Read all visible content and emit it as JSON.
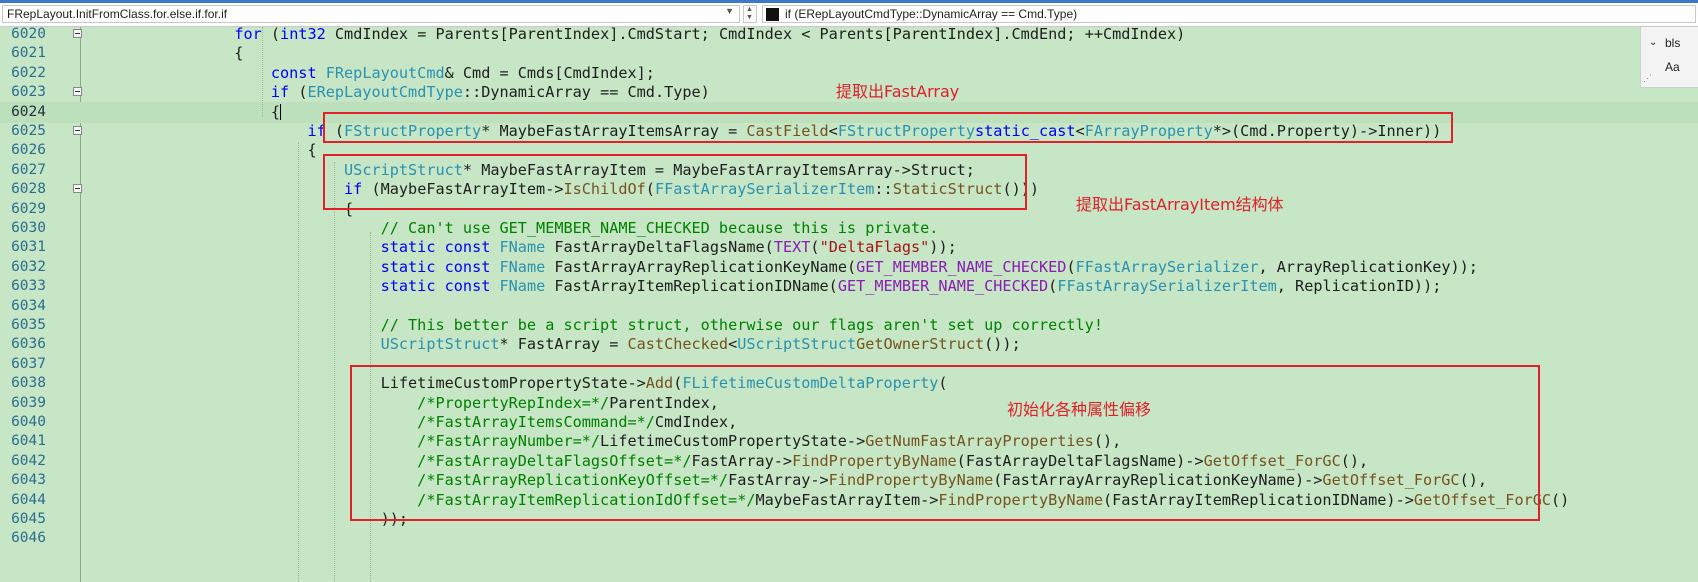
{
  "nav": {
    "scope": "FRepLayout.InitFromClass.for.else.if.for.if",
    "member": "if (ERepLayoutCmdType::DynamicArray == Cmd.Type)"
  },
  "side": {
    "label": "bls",
    "case": "Aa"
  },
  "annotations": {
    "a1": "提取出FastArray",
    "a2": "提取出FastArrayItem结构体",
    "a3": "初始化各种属性偏移"
  },
  "colors": {
    "background": "#c7e6c6",
    "keyword": "#0000ff",
    "type": "#2b91af",
    "function": "#74531f",
    "comment": "#008000",
    "string": "#a31515",
    "annotation": "#e0202a"
  },
  "lines": [
    {
      "n": "6020",
      "fold": true,
      "current": false,
      "tokens": [
        [
          "",
          "                "
        ],
        [
          "kw",
          "for"
        ],
        [
          "",
          " ("
        ],
        [
          "kw",
          "int32"
        ],
        [
          "",
          " CmdIndex = Parents[ParentIndex].CmdStart; CmdIndex < Parents[ParentIndex].CmdEnd; ++CmdIndex)"
        ]
      ]
    },
    {
      "n": "6021",
      "fold": false,
      "current": false,
      "tokens": [
        [
          "",
          "                {"
        ]
      ]
    },
    {
      "n": "6022",
      "fold": false,
      "current": false,
      "tokens": [
        [
          "",
          "                    "
        ],
        [
          "kw",
          "const"
        ],
        [
          "",
          " "
        ],
        [
          "ty",
          "FRepLayoutCmd"
        ],
        [
          "",
          "& Cmd = Cmds[CmdIndex];"
        ]
      ]
    },
    {
      "n": "6023",
      "fold": true,
      "current": false,
      "tokens": [
        [
          "",
          "                    "
        ],
        [
          "kw",
          "if"
        ],
        [
          "",
          " ("
        ],
        [
          "ty",
          "ERepLayoutCmdType"
        ],
        [
          "",
          "::DynamicArray == Cmd.Type)"
        ]
      ]
    },
    {
      "n": "6024",
      "fold": false,
      "current": true,
      "tokens": [
        [
          "",
          "                    {"
        ],
        [
          "caret",
          ""
        ]
      ]
    },
    {
      "n": "6025",
      "fold": true,
      "current": false,
      "tokens": [
        [
          "",
          "                        "
        ],
        [
          "kw",
          "if"
        ],
        [
          "",
          " ("
        ],
        [
          "ty",
          "FStructProperty"
        ],
        [
          "",
          "* MaybeFastArrayItemsArray = "
        ],
        [
          "fn",
          "CastField"
        ],
        [
          "",
          "<"
        ],
        [
          "ty",
          "FStructProperty"
        ],
        [
          ">("
        ],
        [
          "kw",
          "static_cast"
        ],
        [
          "",
          "<"
        ],
        [
          "ty",
          "FArrayProperty"
        ],
        [
          "",
          "*>(Cmd.Property)->Inner))"
        ]
      ]
    },
    {
      "n": "6026",
      "fold": false,
      "current": false,
      "tokens": [
        [
          "",
          "                        {"
        ]
      ]
    },
    {
      "n": "6027",
      "fold": false,
      "current": false,
      "tokens": [
        [
          "",
          "                            "
        ],
        [
          "ty",
          "UScriptStruct"
        ],
        [
          "",
          "* MaybeFastArrayItem = MaybeFastArrayItemsArray->Struct;"
        ]
      ]
    },
    {
      "n": "6028",
      "fold": true,
      "current": false,
      "tokens": [
        [
          "",
          "                            "
        ],
        [
          "kw",
          "if"
        ],
        [
          "",
          " (MaybeFastArrayItem->"
        ],
        [
          "fn",
          "IsChildOf"
        ],
        [
          "",
          "("
        ],
        [
          "ty",
          "FFastArraySerializerItem"
        ],
        [
          "",
          "::"
        ],
        [
          "fn",
          "StaticStruct"
        ],
        [
          "",
          "()))"
        ]
      ]
    },
    {
      "n": "6029",
      "fold": false,
      "current": false,
      "tokens": [
        [
          "",
          "                            {"
        ]
      ]
    },
    {
      "n": "6030",
      "fold": false,
      "current": false,
      "tokens": [
        [
          "",
          "                                "
        ],
        [
          "cm",
          "// Can't use GET_MEMBER_NAME_CHECKED because this is private."
        ]
      ]
    },
    {
      "n": "6031",
      "fold": false,
      "current": false,
      "tokens": [
        [
          "",
          "                                "
        ],
        [
          "kw",
          "static"
        ],
        [
          "",
          " "
        ],
        [
          "kw",
          "const"
        ],
        [
          "",
          " "
        ],
        [
          "ty",
          "FName"
        ],
        [
          "",
          " FastArrayDeltaFlagsName("
        ],
        [
          "mc",
          "TEXT"
        ],
        [
          "",
          "("
        ],
        [
          "st",
          "\"DeltaFlags\""
        ],
        [
          "",
          "));"
        ]
      ]
    },
    {
      "n": "6032",
      "fold": false,
      "current": false,
      "tokens": [
        [
          "",
          "                                "
        ],
        [
          "kw",
          "static"
        ],
        [
          "",
          " "
        ],
        [
          "kw",
          "const"
        ],
        [
          "",
          " "
        ],
        [
          "ty",
          "FName"
        ],
        [
          "",
          " FastArrayArrayReplicationKeyName("
        ],
        [
          "mc",
          "GET_MEMBER_NAME_CHECKED"
        ],
        [
          "",
          "("
        ],
        [
          "ty",
          "FFastArraySerializer"
        ],
        [
          "",
          ", ArrayReplicationKey));"
        ]
      ]
    },
    {
      "n": "6033",
      "fold": false,
      "current": false,
      "tokens": [
        [
          "",
          "                                "
        ],
        [
          "kw",
          "static"
        ],
        [
          "",
          " "
        ],
        [
          "kw",
          "const"
        ],
        [
          "",
          " "
        ],
        [
          "ty",
          "FName"
        ],
        [
          "",
          " FastArrayItemReplicationIDName("
        ],
        [
          "mc",
          "GET_MEMBER_NAME_CHECKED"
        ],
        [
          "",
          "("
        ],
        [
          "ty",
          "FFastArraySerializerItem"
        ],
        [
          "",
          ", ReplicationID));"
        ]
      ]
    },
    {
      "n": "6034",
      "fold": false,
      "current": false,
      "tokens": [
        [
          "",
          ""
        ]
      ]
    },
    {
      "n": "6035",
      "fold": false,
      "current": false,
      "tokens": [
        [
          "",
          "                                "
        ],
        [
          "cm",
          "// This better be a script struct, otherwise our flags aren't set up correctly!"
        ]
      ]
    },
    {
      "n": "6036",
      "fold": false,
      "current": false,
      "tokens": [
        [
          "",
          "                                "
        ],
        [
          "ty",
          "UScriptStruct"
        ],
        [
          "",
          "* FastArray = "
        ],
        [
          "fn",
          "CastChecked"
        ],
        [
          "",
          "<"
        ],
        [
          "ty",
          "UScriptStruct"
        ],
        [
          ">(MaybeFastArrayItemsArray->"
        ],
        [
          "fn",
          "GetOwnerStruct"
        ],
        [
          "",
          "());"
        ]
      ]
    },
    {
      "n": "6037",
      "fold": false,
      "current": false,
      "tokens": [
        [
          "",
          ""
        ]
      ]
    },
    {
      "n": "6038",
      "fold": false,
      "current": false,
      "tokens": [
        [
          "",
          "                                LifetimeCustomPropertyState->"
        ],
        [
          "fn",
          "Add"
        ],
        [
          "",
          "("
        ],
        [
          "ty",
          "FLifetimeCustomDeltaProperty"
        ],
        [
          "",
          "("
        ]
      ]
    },
    {
      "n": "6039",
      "fold": false,
      "current": false,
      "tokens": [
        [
          "",
          "                                    "
        ],
        [
          "cm",
          "/*PropertyRepIndex=*/"
        ],
        [
          "",
          "ParentIndex,"
        ]
      ]
    },
    {
      "n": "6040",
      "fold": false,
      "current": false,
      "tokens": [
        [
          "",
          "                                    "
        ],
        [
          "cm",
          "/*FastArrayItemsCommand=*/"
        ],
        [
          "",
          "CmdIndex,"
        ]
      ]
    },
    {
      "n": "6041",
      "fold": false,
      "current": false,
      "tokens": [
        [
          "",
          "                                    "
        ],
        [
          "cm",
          "/*FastArrayNumber=*/"
        ],
        [
          "",
          "LifetimeCustomPropertyState->"
        ],
        [
          "fn",
          "GetNumFastArrayProperties"
        ],
        [
          "",
          "(),"
        ]
      ]
    },
    {
      "n": "6042",
      "fold": false,
      "current": false,
      "tokens": [
        [
          "",
          "                                    "
        ],
        [
          "cm",
          "/*FastArrayDeltaFlagsOffset=*/"
        ],
        [
          "",
          "FastArray->"
        ],
        [
          "fn",
          "FindPropertyByName"
        ],
        [
          "",
          "(FastArrayDeltaFlagsName)->"
        ],
        [
          "fn",
          "GetOffset_ForGC"
        ],
        [
          "",
          "(),"
        ]
      ]
    },
    {
      "n": "6043",
      "fold": false,
      "current": false,
      "tokens": [
        [
          "",
          "                                    "
        ],
        [
          "cm",
          "/*FastArrayReplicationKeyOffset=*/"
        ],
        [
          "",
          "FastArray->"
        ],
        [
          "fn",
          "FindPropertyByName"
        ],
        [
          "",
          "(FastArrayArrayReplicationKeyName)->"
        ],
        [
          "fn",
          "GetOffset_ForGC"
        ],
        [
          "",
          "(),"
        ]
      ]
    },
    {
      "n": "6044",
      "fold": false,
      "current": false,
      "tokens": [
        [
          "",
          "                                    "
        ],
        [
          "cm",
          "/*FastArrayItemReplicationIdOffset=*/"
        ],
        [
          "",
          "MaybeFastArrayItem->"
        ],
        [
          "fn",
          "FindPropertyByName"
        ],
        [
          "",
          "(FastArrayItemReplicationIDName)->"
        ],
        [
          "fn",
          "GetOffset_ForGC"
        ],
        [
          "",
          "()"
        ]
      ]
    },
    {
      "n": "6045",
      "fold": false,
      "current": false,
      "tokens": [
        [
          "",
          "                                ));"
        ]
      ]
    },
    {
      "n": "6046",
      "fold": false,
      "current": false,
      "tokens": [
        [
          "",
          ""
        ]
      ]
    }
  ]
}
